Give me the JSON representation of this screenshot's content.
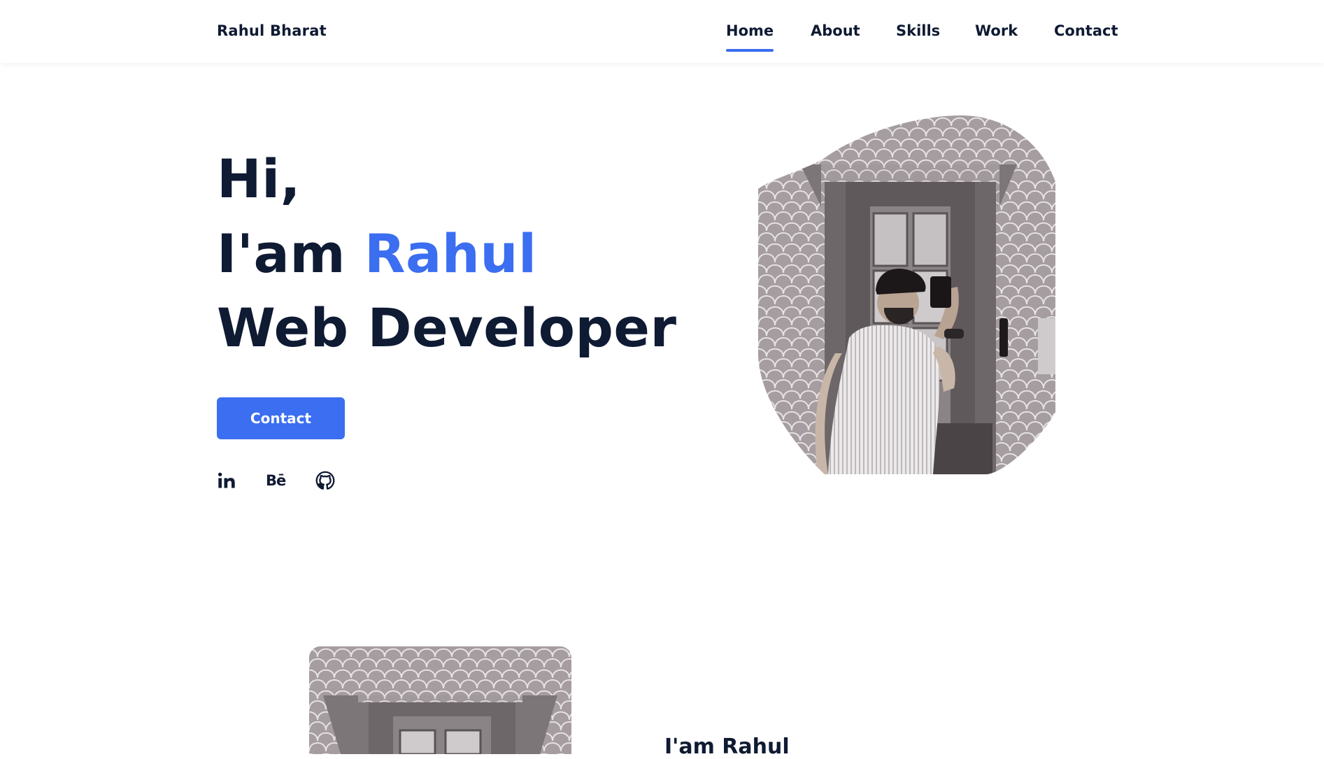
{
  "header": {
    "brand": "Rahul Bharat",
    "nav": [
      "Home",
      "About",
      "Skills",
      "Work",
      "Contact"
    ],
    "active_nav": "Home"
  },
  "hero": {
    "line1": "Hi,",
    "line2_prefix": "I'am ",
    "line2_name": "Rahul",
    "line3": "Web Developer",
    "contact_button": "Contact",
    "social_icons": [
      "linkedin-icon",
      "behance-icon",
      "github-icon"
    ],
    "behance_glyph": "Bē"
  },
  "about": {
    "heading": "I'am Rahul"
  },
  "colors": {
    "accent": "#3b6ef0",
    "text": "#0f1a33",
    "background": "#ffffff"
  }
}
